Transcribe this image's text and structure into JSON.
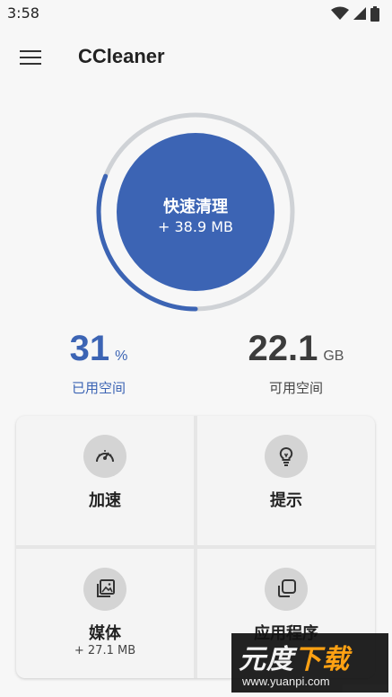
{
  "status_bar": {
    "time": "3:58",
    "icons": [
      "wifi-icon",
      "signal-icon",
      "battery-icon"
    ]
  },
  "app_bar": {
    "title": "CCleaner",
    "menu_icon": "menu-icon"
  },
  "quick_clean": {
    "label": "快速清理",
    "size": "+ 38.9 MB",
    "ring_progress": 0.31,
    "colors": {
      "accent": "#3c64b4",
      "track": "#cfd2d6"
    }
  },
  "storage": {
    "used": {
      "value": "31",
      "unit": "%",
      "label": "已用空间"
    },
    "free": {
      "value": "22.1",
      "unit": "GB",
      "label": "可用空间"
    }
  },
  "tiles": [
    {
      "label": "加速",
      "sub": "",
      "icon": "speedometer-icon"
    },
    {
      "label": "提示",
      "sub": "",
      "icon": "lightbulb-icon"
    },
    {
      "label": "媒体",
      "sub": "+ 27.1 MB",
      "icon": "image-stack-icon"
    },
    {
      "label": "应用程序",
      "sub": "",
      "icon": "apps-stack-icon"
    }
  ],
  "watermark": {
    "main_part_1": "元度",
    "main_part_2": "下载",
    "url": "www.yuanpi.com"
  }
}
